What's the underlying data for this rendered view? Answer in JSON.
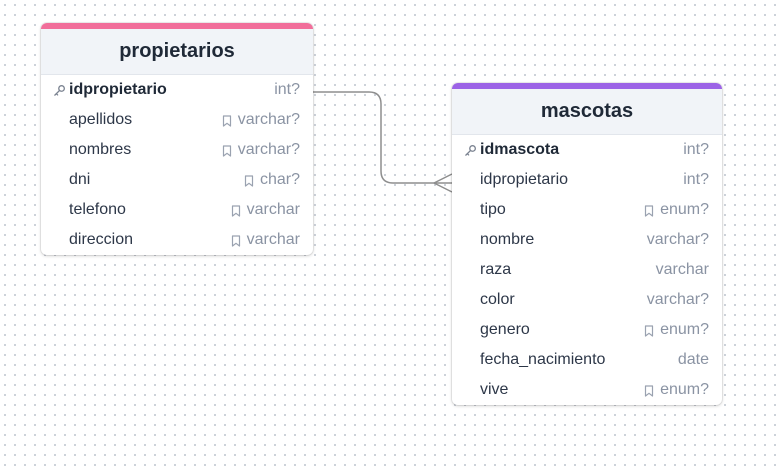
{
  "colors": {
    "propietarios_accent": "#f16e9a",
    "mascotas_accent": "#9c63e6",
    "connector": "#8e8e8e"
  },
  "tables": {
    "propietarios": {
      "title": "propietarios",
      "fields": [
        {
          "name": "idpropietario",
          "type": "int?",
          "pk": true,
          "icon": "key-icon"
        },
        {
          "name": "apellidos",
          "type": "varchar?",
          "icon": "enum-bookmark-icon"
        },
        {
          "name": "nombres",
          "type": "varchar?",
          "icon": "enum-bookmark-icon"
        },
        {
          "name": "dni",
          "type": "char?",
          "icon": "enum-bookmark-icon"
        },
        {
          "name": "telefono",
          "type": "varchar",
          "icon": "enum-bookmark-icon"
        },
        {
          "name": "direccion",
          "type": "varchar",
          "icon": "enum-bookmark-icon"
        }
      ]
    },
    "mascotas": {
      "title": "mascotas",
      "fields": [
        {
          "name": "idmascota",
          "type": "int?",
          "pk": true,
          "icon": "key-icon"
        },
        {
          "name": "idpropietario",
          "type": "int?"
        },
        {
          "name": "tipo",
          "type": "enum?",
          "icon": "enum-bookmark-icon"
        },
        {
          "name": "nombre",
          "type": "varchar?"
        },
        {
          "name": "raza",
          "type": "varchar"
        },
        {
          "name": "color",
          "type": "varchar?"
        },
        {
          "name": "genero",
          "type": "enum?",
          "icon": "enum-bookmark-icon"
        },
        {
          "name": "fecha_nacimiento",
          "type": "date"
        },
        {
          "name": "vive",
          "type": "enum?",
          "icon": "enum-bookmark-icon"
        }
      ]
    }
  }
}
